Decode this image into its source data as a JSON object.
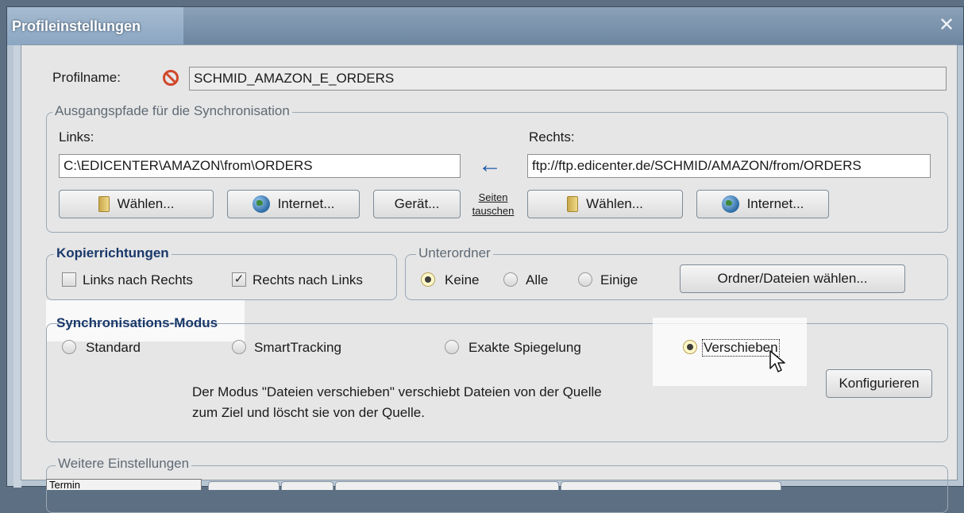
{
  "window": {
    "title": "Profileinstellungen",
    "close_glyph": "✕"
  },
  "profile": {
    "label": "Profilname:",
    "value": "SCHMID_AMAZON_E_ORDERS",
    "icon": "no-entry-icon"
  },
  "paths": {
    "group_label": "Ausgangspfade für die Synchronisation",
    "left": {
      "label": "Links:",
      "value": "C:\\EDICENTER\\AMAZON\\from\\ORDERS"
    },
    "right": {
      "label": "Rechts:",
      "value": "ftp://ftp.edicenter.de/SCHMID/AMAZON/from/ORDERS"
    },
    "arrow": "←",
    "swap_line1": "Seiten",
    "swap_line2": "tauschen",
    "buttons": {
      "left_choose": "Wählen...",
      "left_internet": "Internet...",
      "device": "Gerät...",
      "right_choose": "Wählen...",
      "right_internet": "Internet..."
    }
  },
  "copy": {
    "group_label": "Kopierrichtungen",
    "left_to_right": {
      "label": "Links nach Rechts",
      "checked": false
    },
    "right_to_left": {
      "label": "Rechts nach Links",
      "checked": true
    }
  },
  "subfolders": {
    "group_label": "Unterordner",
    "options": [
      "Keine",
      "Alle",
      "Einige"
    ],
    "selected": "Keine",
    "choose_button": "Ordner/Dateien wählen..."
  },
  "sync_mode": {
    "group_label": "Synchronisations-Modus",
    "options": [
      "Standard",
      "SmartTracking",
      "Exakte Spiegelung",
      "Verschieben"
    ],
    "selected": "Verschieben",
    "description_line1": "Der Modus \"Dateien verschieben\" verschiebt Dateien von der Quelle",
    "description_line2": "zum Ziel und löscht sie von der Quelle.",
    "configure_button": "Konfigurieren"
  },
  "more": {
    "group_label": "Weitere Einstellungen",
    "tab_partial": "Termin"
  },
  "colors": {
    "accent_blue": "#19386a",
    "title_bar": "#7890a8",
    "panel": "#e6e6e6"
  }
}
